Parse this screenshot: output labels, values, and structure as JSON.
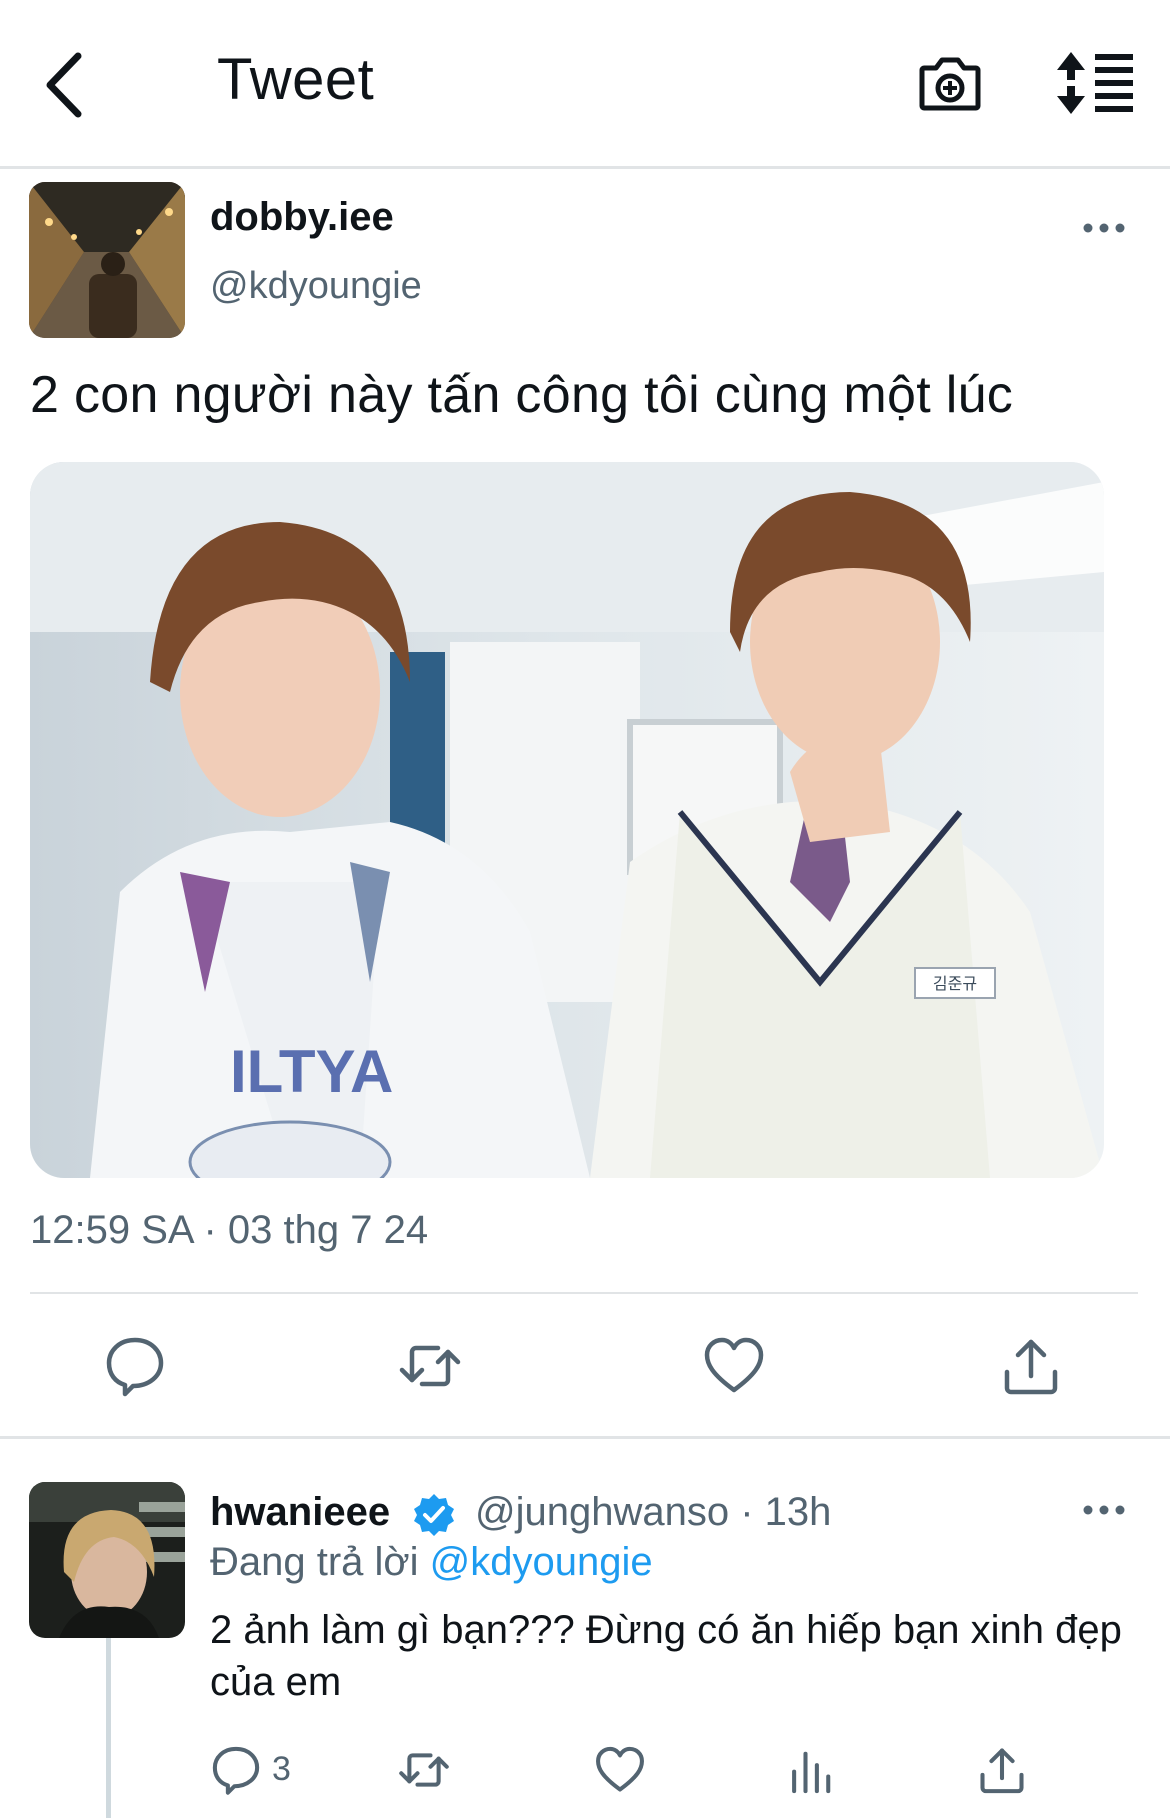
{
  "header": {
    "title": "Tweet",
    "icons": [
      "back-arrow",
      "camera-plus",
      "sort-lines"
    ]
  },
  "tweet": {
    "display_name": "dobby.iee",
    "handle": "@kdyoungie",
    "text": "2 con người này tấn công tôi cùng một lúc",
    "photo_label_badge": "김준규",
    "photo_shirt_text": "ILTYA",
    "timestamp": "12:59 SA · 03 thg 7 24",
    "actions": [
      "reply",
      "retweet",
      "like",
      "share"
    ]
  },
  "reply": {
    "display_name": "hwanieee",
    "verified": true,
    "handle_time": "@junghwanso · 13h",
    "replying_prefix": "Đang trả lời",
    "replying_mention": "@kdyoungie",
    "text": "2 ảnh làm gì bạn??? Đừng có ăn hiếp bạn xinh đẹp của em",
    "reply_count": "3",
    "actions": [
      "reply",
      "retweet",
      "like",
      "views",
      "share"
    ]
  },
  "colors": {
    "text_primary": "#0f1419",
    "text_secondary": "#536471",
    "accent": "#1d9bf0",
    "divider": "#e1e4e6"
  }
}
